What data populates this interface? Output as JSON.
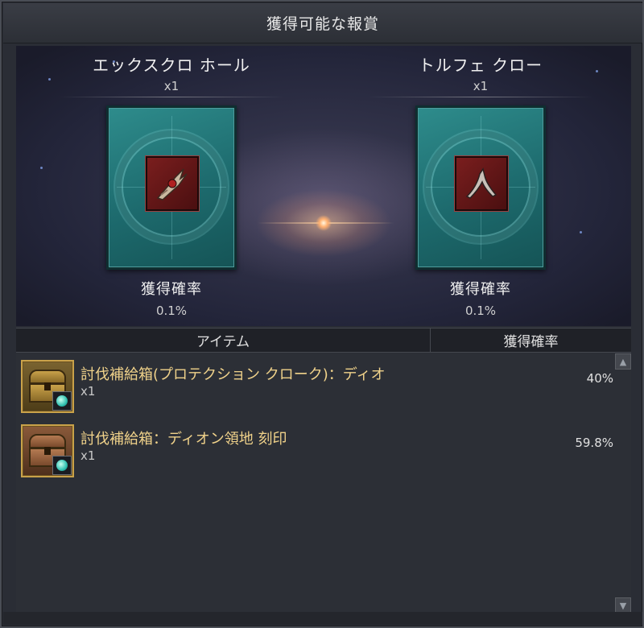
{
  "window": {
    "title": "獲得可能な報賞"
  },
  "rewards": [
    {
      "name": "エックスクロ ホール",
      "qty": "x1",
      "rate_label": "獲得確率",
      "rate": "0.1%",
      "item_icon": "claw-weapon-icon"
    },
    {
      "name": "トルフェ クロー",
      "qty": "x1",
      "rate_label": "獲得確率",
      "rate": "0.1%",
      "item_icon": "claw-weapon-icon"
    }
  ],
  "list": {
    "header_item": "アイテム",
    "header_rate": "獲得確率",
    "items": [
      {
        "name": "討伐補給箱(プロテクション クローク)：ディオ",
        "qty": "x1",
        "rate": "40%",
        "icon": "gold-chest-icon"
      },
      {
        "name": "討伐補給箱：ディオン領地 刻印",
        "qty": "x1",
        "rate": "59.8%",
        "icon": "bronze-chest-icon"
      }
    ]
  },
  "colors": {
    "card_teal": "#1d6a6d",
    "item_name_gold": "#f0d28a",
    "slot_border": "#c9a24a"
  }
}
